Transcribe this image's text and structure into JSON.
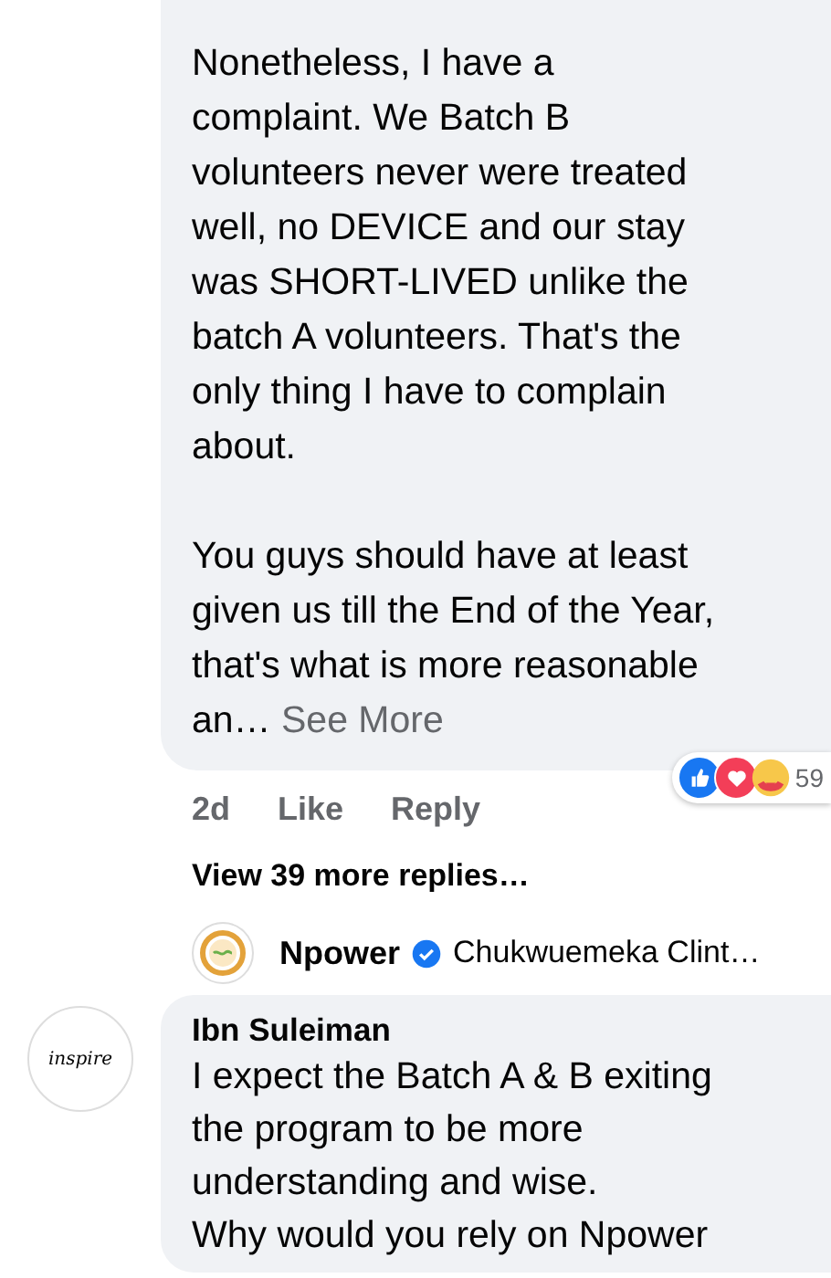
{
  "comments": [
    {
      "kind": "partial",
      "paragraphs": [
        "Nonetheless, I have a\ncomplaint. We Batch B\nvolunteers never were treated\nwell, no DEVICE and our stay\nwas SHORT-LIVED unlike the\nbatch A volunteers. That's the\nonly thing I have to complain\nabout.",
        "You guys should have at least\ngiven us till the End of the Year,\nthat's what is more reasonable\nan…"
      ],
      "see_more": "See More",
      "time": "2d",
      "actions": [
        "Like",
        "Reply"
      ],
      "reaction_count": "59",
      "view_replies": "View 39 more replies…",
      "latest_reply": {
        "author": "Npower",
        "verified": true,
        "preview": "Chukwuemeka Clint…"
      }
    },
    {
      "kind": "full",
      "author": "Ibn Suleiman",
      "avatar_text": "inspire",
      "paragraphs": [
        "I expect the Batch A & B exiting\nthe program to be more\nunderstanding and wise.\nWhy would you rely on Npower"
      ]
    }
  ]
}
